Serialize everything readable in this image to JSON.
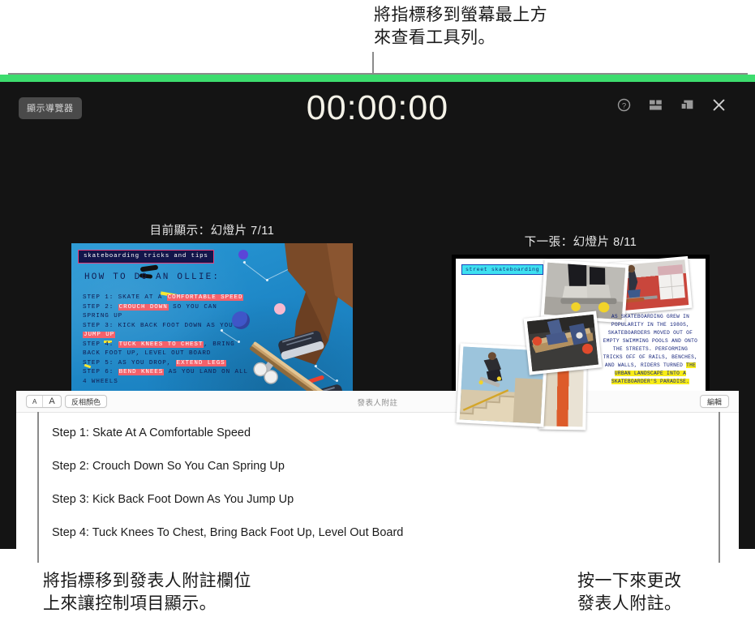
{
  "annotations": {
    "top": "將指標移到螢幕最上方\n來查看工具列。",
    "bottom_left": "將指標移到發表人附註欄位\n上來讓控制項目顯示。",
    "bottom_right": "按一下來更改\n發表人附註。"
  },
  "presenter": {
    "accent_bar_color": "#3ddc6e",
    "background_color": "#141414",
    "navigator_button": "顯示導覽器",
    "timer": "00:00:00",
    "toolbar_icons": [
      {
        "name": "help-icon",
        "glyph": "?"
      },
      {
        "name": "layout-icon",
        "glyph": "▤"
      },
      {
        "name": "swap-displays-icon",
        "glyph": "⧉"
      },
      {
        "name": "close-icon",
        "glyph": "✕"
      }
    ],
    "current_slide": {
      "label": "目前顯示：幻燈片 7/11",
      "tag": "skateboarding tricks and tips",
      "heading": "HOW TO DO AN OLLIE:",
      "steps": [
        {
          "prefix": "STEP 1: ",
          "segments": [
            {
              "text": "SKATE AT A ",
              "hl": false
            },
            {
              "text": "COMFORTABLE SPEED",
              "hl": true
            }
          ]
        },
        {
          "prefix": "STEP 2: ",
          "segments": [
            {
              "text": "CROUCH DOWN",
              "hl": true
            },
            {
              "text": " SO YOU CAN",
              "hl": false
            }
          ]
        },
        {
          "prefix": "",
          "segments": [
            {
              "text": "        SPRING UP",
              "hl": false
            }
          ]
        },
        {
          "prefix": "STEP 3: ",
          "segments": [
            {
              "text": "KICK BACK FOOT DOWN AS YOU",
              "hl": false
            }
          ]
        },
        {
          "prefix": "",
          "segments": [
            {
              "text": "JUMP UP",
              "hl": true
            }
          ]
        },
        {
          "prefix": "STEP 4: ",
          "segments": [
            {
              "text": "TUCK KNEES TO CHEST",
              "hl": true
            },
            {
              "text": ", BRING",
              "hl": false
            }
          ]
        },
        {
          "prefix": "",
          "segments": [
            {
              "text": "        BACK FOOT UP, LEVEL OUT BOARD",
              "hl": false
            }
          ]
        },
        {
          "prefix": "STEP 5: ",
          "segments": [
            {
              "text": "AS YOU DROP, ",
              "hl": false
            },
            {
              "text": "EXTEND LEGS",
              "hl": true
            }
          ]
        },
        {
          "prefix": "STEP 6: ",
          "segments": [
            {
              "text": "BEND KNEES",
              "hl": true
            },
            {
              "text": " AS YOU LAND ON ALL",
              "hl": false
            }
          ]
        },
        {
          "prefix": "",
          "segments": [
            {
              "text": "        4 WHEELS",
              "hl": false
            }
          ]
        }
      ]
    },
    "next_slide": {
      "label": "下一張：幻燈片 8/11",
      "tag": "street skateboarding",
      "body_plain_1": "AS SKATEBOARDING GREW IN POPULARITY IN THE 1980S, SKATEBOARDERS MOVED OUT OF EMPTY SWIMMING POOLS AND ONTO THE STREETS. PERFORMING TRICKS OFF OF RAILS, BENCHES, AND WALLS, RIDERS TURNED ",
      "body_highlight": "THE URBAN LANDSCAPE INTO A SKATEBOARDER'S PARADISE.",
      "highlight_color": "#f7ec17"
    },
    "notes": {
      "title": "發表人附註",
      "font_small_label": "A",
      "font_large_label": "A",
      "invert_colors_label": "反相顏色",
      "edit_label": "編輯",
      "lines": [
        "Step 1: Skate At A Comfortable Speed",
        "Step 2: Crouch Down So You Can Spring Up",
        "Step 3: Kick Back Foot Down As You Jump Up",
        "Step 4: Tuck Knees To Chest, Bring Back Foot Up, Level Out Board"
      ]
    }
  }
}
